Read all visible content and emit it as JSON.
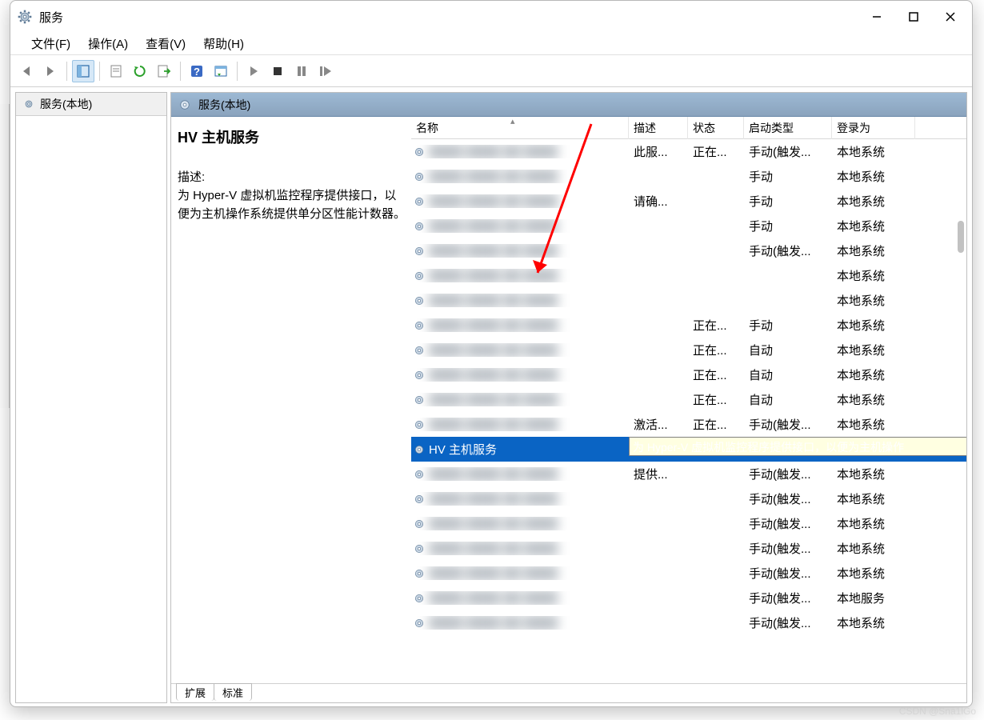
{
  "window": {
    "title": "服务",
    "minimize": "—",
    "maximize": "☐",
    "close": "✕"
  },
  "menu": {
    "file": "文件(F)",
    "action": "操作(A)",
    "view": "查看(V)",
    "help": "帮助(H)"
  },
  "tree": {
    "root": "服务(本地)"
  },
  "pane": {
    "title": "服务(本地)"
  },
  "detail": {
    "title": "HV 主机服务",
    "desc_label": "描述:",
    "desc_text": "为 Hyper-V 虚拟机监控程序提供接口，以便为主机操作系统提供单分区性能计数器。"
  },
  "columns": {
    "name": "名称",
    "desc": "描述",
    "status": "状态",
    "startup": "启动类型",
    "logon": "登录为"
  },
  "tooltip": "为 Hyper-V 虚拟机监控程序提供接口，以便为主机操作",
  "tabs": {
    "extended": "扩展",
    "standard": "标准"
  },
  "watermark": "CSDN @Sna1lGo",
  "rows": [
    {
      "name": "",
      "desc": "此服...",
      "status": "正在...",
      "startup": "手动(触发...",
      "logon": "本地系统",
      "blur": true
    },
    {
      "name": "",
      "desc": "",
      "status": "",
      "startup": "手动",
      "logon": "本地系统",
      "blur": true
    },
    {
      "name": "",
      "desc": "请确...",
      "status": "",
      "startup": "手动",
      "logon": "本地系统",
      "blur": true
    },
    {
      "name": "",
      "desc": "",
      "status": "",
      "startup": "手动",
      "logon": "本地系统",
      "blur": true
    },
    {
      "name": "",
      "desc": "",
      "status": "",
      "startup": "手动(触发...",
      "logon": "本地系统",
      "blur": true
    },
    {
      "name": "",
      "desc": "",
      "status": "",
      "startup": "",
      "logon": "本地系统",
      "blur": true
    },
    {
      "name": "",
      "desc": "",
      "status": "",
      "startup": "",
      "logon": "本地系统",
      "blur": true
    },
    {
      "name": "",
      "desc": "",
      "status": "正在...",
      "startup": "手动",
      "logon": "本地系统",
      "blur": true
    },
    {
      "name": "",
      "desc": "",
      "status": "正在...",
      "startup": "自动",
      "logon": "本地系统",
      "blur": true
    },
    {
      "name": "",
      "desc": "",
      "status": "正在...",
      "startup": "自动",
      "logon": "本地系统",
      "blur": true
    },
    {
      "name": "",
      "desc": "",
      "status": "正在...",
      "startup": "自动",
      "logon": "本地系统",
      "blur": true
    },
    {
      "name": "",
      "desc": "激活...",
      "status": "正在...",
      "startup": "手动(触发...",
      "logon": "本地系统",
      "blur": true
    },
    {
      "name": "HV 主机服务",
      "desc": "",
      "status": "",
      "startup": "",
      "logon": "",
      "blur": false,
      "selected": true,
      "tooltip": true
    },
    {
      "name": "",
      "desc": "提供...",
      "status": "",
      "startup": "手动(触发...",
      "logon": "本地系统",
      "blur": true
    },
    {
      "name": "",
      "desc": "",
      "status": "",
      "startup": "手动(触发...",
      "logon": "本地系统",
      "blur": true
    },
    {
      "name": "",
      "desc": "",
      "status": "",
      "startup": "手动(触发...",
      "logon": "本地系统",
      "blur": true
    },
    {
      "name": "",
      "desc": "",
      "status": "",
      "startup": "手动(触发...",
      "logon": "本地系统",
      "blur": true
    },
    {
      "name": "",
      "desc": "",
      "status": "",
      "startup": "手动(触发...",
      "logon": "本地系统",
      "blur": true
    },
    {
      "name": "",
      "desc": "",
      "status": "",
      "startup": "手动(触发...",
      "logon": "本地服务",
      "blur": true
    },
    {
      "name": "",
      "desc": "",
      "status": "",
      "startup": "手动(触发...",
      "logon": "本地系统",
      "blur": true
    }
  ]
}
